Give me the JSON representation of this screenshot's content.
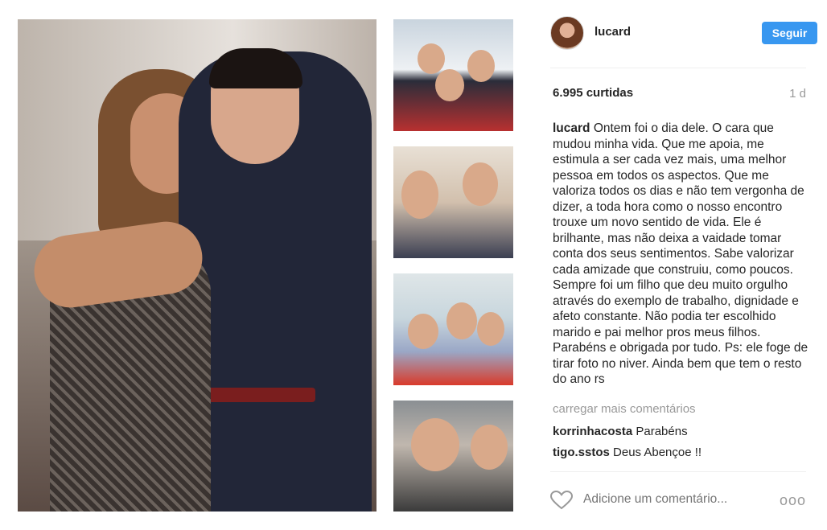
{
  "post": {
    "username": "lucard",
    "follow_label": "Seguir",
    "likes": "6.995 curtidas",
    "time": "1 d",
    "caption_user": "lucard",
    "caption_text": "Ontem foi o dia dele. O cara que mudou minha vida. Que me apoia, me estimula a ser cada vez mais, uma melhor pessoa em todos os aspectos. Que me valoriza todos os dias e não tem vergonha de dizer, a toda hora como o nosso encontro trouxe um novo sentido de vida. Ele é brilhante, mas não deixa a vaidade tomar conta dos seus sentimentos. Sabe valorizar cada amizade que construiu, como poucos. Sempre foi um filho que deu muito orgulho através do exemplo de trabalho, dignidade e afeto constante. Não podia ter escolhido marido e pai melhor pros meus filhos. Parabéns e obrigada por tudo. Ps: ele foge de tirar foto no niver. Ainda bem que tem o resto do ano rs",
    "load_more": "carregar mais comentários",
    "comments": [
      {
        "user": "korrinhacosta",
        "text": "Parabéns"
      },
      {
        "user": "tigo.sstos",
        "text": "Deus Abençoe !!"
      }
    ],
    "add_comment_placeholder": "Adicione um comentário...",
    "more_options": "ooo"
  },
  "colors": {
    "follow_button": "#3897f0",
    "muted_text": "#999999",
    "divider": "#efefef"
  },
  "icons": {
    "like": "heart-icon",
    "options": "ellipsis-icon"
  }
}
